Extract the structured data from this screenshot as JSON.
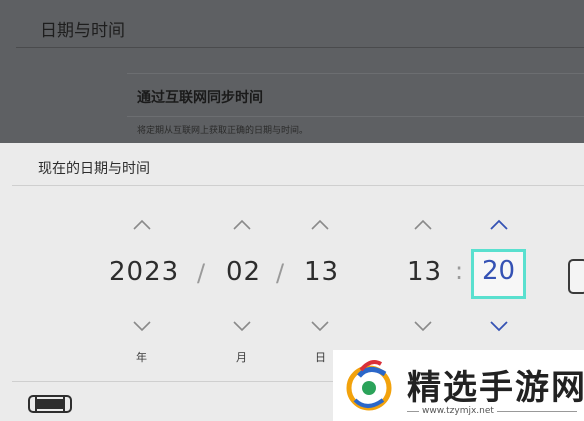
{
  "background": {
    "title": "日期与时间",
    "sync_row": {
      "title": "通过互联网同步时间",
      "description": "将定期从互联网上获取正确的日期与时间。"
    }
  },
  "dialog": {
    "title": "现在的日期与时间",
    "fields": {
      "year": {
        "value": "2023",
        "unit": "年"
      },
      "month": {
        "value": "02",
        "unit": "月"
      },
      "day": {
        "value": "13",
        "unit": "日"
      },
      "hour": {
        "value": "13"
      },
      "minute": {
        "value": "20"
      }
    },
    "separators": {
      "date": "/",
      "time": ":"
    }
  },
  "watermark": {
    "text": "精选手游网",
    "url": "www.tzymjx.net"
  },
  "colors": {
    "focus": "#5ae0cf",
    "focus_value": "#3552b4",
    "active_chevron": "#3552b4"
  }
}
